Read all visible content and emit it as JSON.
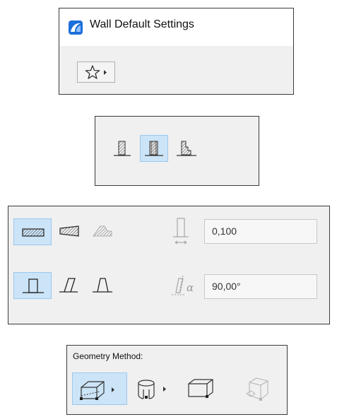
{
  "dialog": {
    "title": "Wall Default Settings",
    "icons": {
      "app": "archicad-app-icon",
      "favorites": "star-icon",
      "favorites_menu": "triangle-right-icon"
    }
  },
  "structure": {
    "options": [
      {
        "icon": "wall-basic-icon",
        "selected": false
      },
      {
        "icon": "wall-composite-icon",
        "selected": true
      },
      {
        "icon": "wall-profile-icon",
        "selected": false
      }
    ]
  },
  "geometry": {
    "shape_options": [
      {
        "icon": "wall-straight-icon",
        "selected": true
      },
      {
        "icon": "wall-trapezoid-icon",
        "selected": false
      },
      {
        "icon": "wall-polygonal-icon",
        "selected": false
      }
    ],
    "slant_options": [
      {
        "icon": "wall-upright-icon",
        "selected": true
      },
      {
        "icon": "wall-slanted-icon",
        "selected": false
      },
      {
        "icon": "wall-double-slanted-icon",
        "selected": false
      }
    ],
    "thickness": {
      "icon": "thickness-icon",
      "value": "0,100"
    },
    "angle": {
      "icon": "angle-icon",
      "value": "90,00°"
    }
  },
  "geometry_method": {
    "label": "Geometry Method:",
    "options": [
      {
        "icon": "straight-wall-method-icon",
        "selected": true,
        "has_menu": true
      },
      {
        "icon": "curved-wall-method-icon",
        "selected": false,
        "has_menu": true
      },
      {
        "icon": "rectangle-wall-method-icon",
        "selected": false,
        "has_menu": false
      },
      {
        "icon": "rotated-rectangle-wall-method-icon",
        "selected": false,
        "has_menu": false
      }
    ]
  },
  "colors": {
    "selected_bg": "#cce4f7",
    "selected_border": "#99c9ef",
    "panel_bg": "#f0f0f0",
    "app_icon": "#1e6fd9"
  }
}
